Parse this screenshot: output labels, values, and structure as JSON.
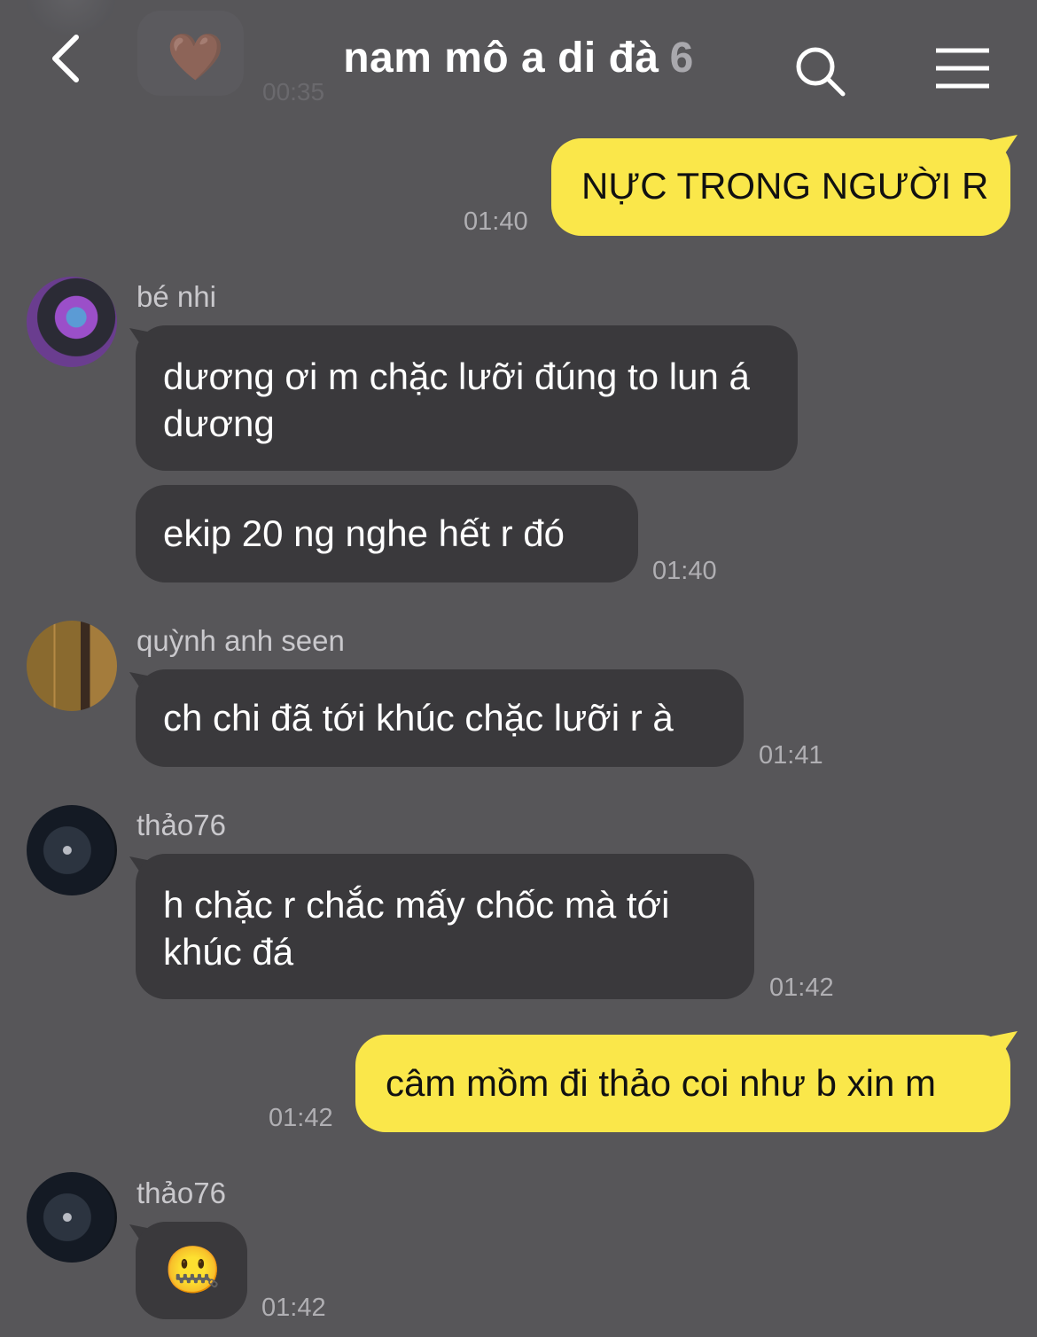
{
  "header": {
    "title": "nam mô a di đà",
    "member_count": "6"
  },
  "faded_previous": {
    "time": "00:35",
    "emoji": "🤎"
  },
  "messages": [
    {
      "direction": "out",
      "text": "NỰC TRONG NGƯỜI R",
      "time": "01:40"
    },
    {
      "direction": "in",
      "sender": "bé nhi",
      "text": "dương ơi m chặc lưỡi đúng to lun á dương"
    },
    {
      "direction": "in",
      "text": "ekip 20 ng nghe hết r đó",
      "time": "01:40"
    },
    {
      "direction": "in",
      "sender": "quỳnh anh seen",
      "text": "ch chi đã tới khúc chặc lưỡi r à",
      "time": "01:41"
    },
    {
      "direction": "in",
      "sender": "thảo76",
      "text": "h chặc r chắc mấy chốc mà tới khúc đá",
      "time": "01:42"
    },
    {
      "direction": "out",
      "text": "câm mồm đi thảo coi như b xin m",
      "time": "01:42"
    },
    {
      "direction": "in",
      "sender": "thảo76",
      "text": "🤐",
      "time": "01:42"
    }
  ],
  "colors": {
    "background": "#575659",
    "incoming_bubble": "#3a393c",
    "outgoing_bubble": "#fae74a"
  }
}
